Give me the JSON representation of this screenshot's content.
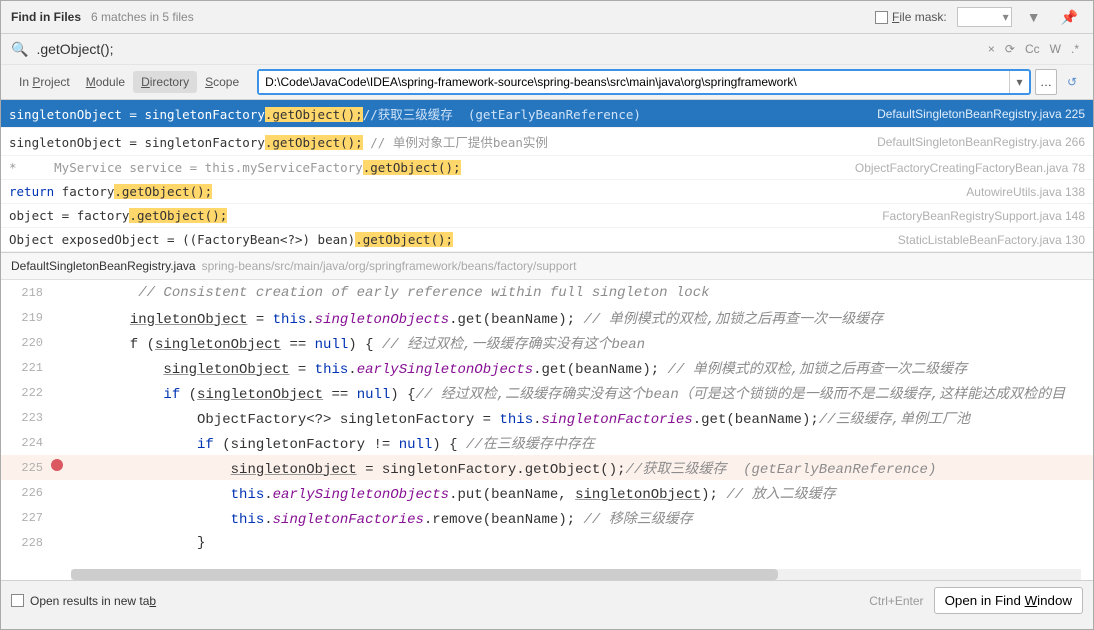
{
  "header": {
    "title": "Find in Files",
    "sub": "6 matches in 5 files",
    "filemask_label": "File mask:"
  },
  "search": {
    "value": ".getObject();",
    "cc": "Cc",
    "w": "W",
    "regex": ".*"
  },
  "scope": {
    "tabs": [
      {
        "html": "In <u>P</u>roject"
      },
      {
        "html": "<u>M</u>odule"
      },
      {
        "html": "<u>D</u>irectory"
      },
      {
        "html": "<u>S</u>cope"
      }
    ],
    "dir": "D:\\Code\\JavaCode\\IDEA\\spring-framework-source\\spring-beans\\src\\main\\java\\org\\springframework\\"
  },
  "results": [
    {
      "selected": true,
      "code_html": "singletonObject = singletonFactory<span class='hl'>.getObject();</span><span class='cm'>//获取三级缓存 &nbsp;(getEarlyBeanReference)</span>",
      "file": "DefaultSingletonBeanRegistry.java",
      "line": "225"
    },
    {
      "code_html": "singletonObject = singletonFactory<span class='hl'>.getObject();</span> <span class='cm'>// 单例对象工厂提供bean实例</span>",
      "file": "DefaultSingletonBeanRegistry.java",
      "line": "266"
    },
    {
      "code_html": "<span class='cm'>* &nbsp; &nbsp; MyService service = this.myServiceFactory</span><span class='hl'>.getObject();</span>",
      "file": "ObjectFactoryCreatingFactoryBean.java",
      "line": "78"
    },
    {
      "code_html": "<span class='kw'>return</span> factory<span class='hl'>.getObject();</span>",
      "file": "AutowireUtils.java",
      "line": "138"
    },
    {
      "code_html": "object = factory<span class='hl'>.getObject();</span>",
      "file": "FactoryBeanRegistrySupport.java",
      "line": "148"
    },
    {
      "code_html": "Object exposedObject = ((FactoryBean&lt;?&gt;) bean)<span class='hl'>.getObject();</span>",
      "file": "StaticListableBeanFactory.java",
      "line": "130"
    }
  ],
  "preview": {
    "filename": "DefaultSingletonBeanRegistry.java",
    "path": "spring-beans/src/main/java/org/springframework/beans/factory/support",
    "lines": [
      {
        "n": "218",
        "html": "        <span class='c-cm'>// Consistent creation of early reference within full singleton lock</span>"
      },
      {
        "n": "219",
        "html": "       <span class='und'>ingletonObject</span> = <span class='c-kw'>this</span>.<span class='c-prop'>singletonObjects</span>.get(beanName); <span class='c-cm'>// 单例模式的双检,加锁之后再查一次一级缓存</span>"
      },
      {
        "n": "220",
        "html": "       f (<span class='und'>singletonObject</span> == <span class='c-kw'>null</span>) { <span class='c-cm'>// 经过双检,一级缓存确实没有这个bean</span>"
      },
      {
        "n": "221",
        "html": "           <span class='und'>singletonObject</span> = <span class='c-kw'>this</span>.<span class='c-prop'>earlySingletonObjects</span>.get(beanName); <span class='c-cm'>// 单例模式的双检,加锁之后再查一次二级缓存</span>"
      },
      {
        "n": "222",
        "html": "           <span class='c-kw'>if</span> (<span class='und'>singletonObject</span> == <span class='c-kw'>null</span>) {<span class='c-cm'>// 经过双检,二级缓存确实没有这个bean（可是这个锁锁的是一级而不是二级缓存,这样能达成双检的目</span>"
      },
      {
        "n": "223",
        "html": "               <span class='c-type'>ObjectFactory&lt;?&gt;</span> singletonFactory = <span class='c-kw'>this</span>.<span class='c-prop'>singletonFactories</span>.get(beanName);<span class='c-cm'>//三级缓存,单例工厂池</span>"
      },
      {
        "n": "224",
        "html": "               <span class='c-kw'>if</span> (singletonFactory != <span class='c-kw'>null</span>) { <span class='c-cm'>//在三级缓存中存在</span>"
      },
      {
        "n": "225",
        "bp": true,
        "hl": true,
        "html": "                   <span class='und'>singletonObject</span> = singletonFactory.getObject();<span class='c-cm'>//获取三级缓存  (getEarlyBeanReference)</span>"
      },
      {
        "n": "226",
        "html": "                   <span class='c-kw'>this</span>.<span class='c-prop'>earlySingletonObjects</span>.put(beanName, <span class='und'>singletonObject</span>); <span class='c-cm'>// 放入二级缓存</span>"
      },
      {
        "n": "227",
        "html": "                   <span class='c-kw'>this</span>.<span class='c-prop'>singletonFactories</span>.remove(beanName); <span class='c-cm'>// 移除三级缓存</span>"
      },
      {
        "n": "228",
        "html": "               }"
      }
    ]
  },
  "footer": {
    "checkbox": "Open results in new tab",
    "hint": "Ctrl+Enter",
    "button": "Open in Find Window"
  }
}
